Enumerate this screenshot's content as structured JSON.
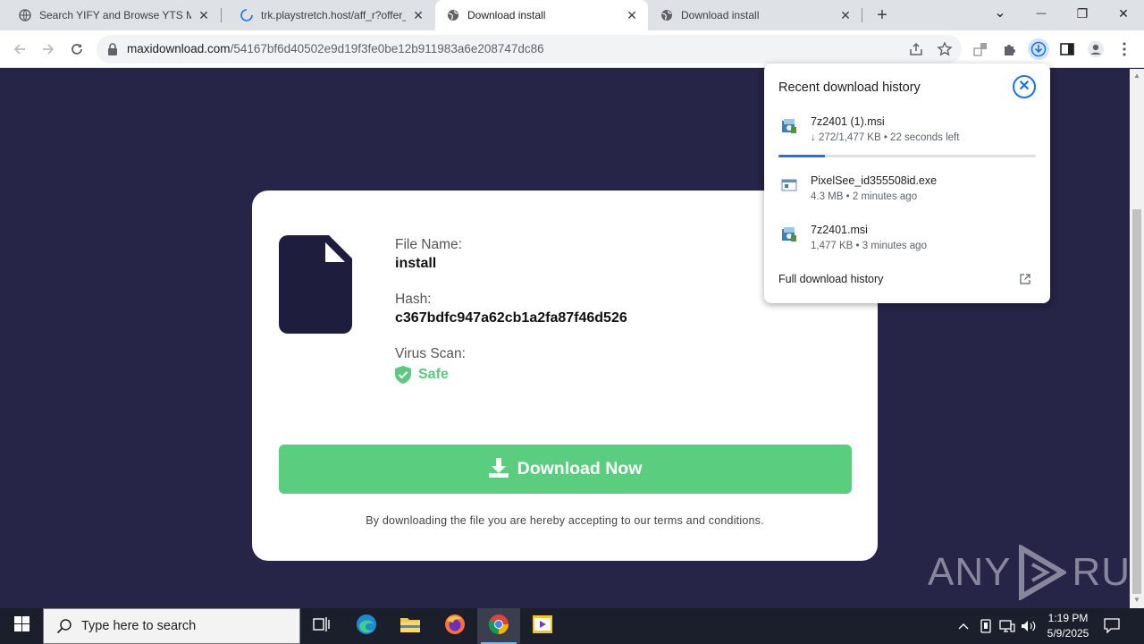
{
  "browser": {
    "tabs": [
      {
        "title": "Search YIFY and Browse YTS Mo",
        "favicon": "globe-icon"
      },
      {
        "title": "trk.playstretch.host/aff_r?offer_id",
        "favicon": "loading-icon"
      },
      {
        "title": "Download install",
        "favicon": "globe-icon",
        "active": true
      },
      {
        "title": "Download install",
        "favicon": "globe-icon"
      }
    ],
    "new_tab_symbol": "+",
    "window_controls": {
      "dropdown": "⌄",
      "minimize": "—",
      "restore": "❐",
      "close": "✕"
    },
    "address_domain": "maxidownload.com",
    "address_path": "/54167bf6d40502e9d19f3fe0be12b911983a6e208747dc86"
  },
  "page": {
    "file_name_label": "File Name:",
    "file_name": "install",
    "hash_label": "Hash:",
    "hash": "c367bdfc947a62cb1a2fa87f46d526",
    "virus_scan_label": "Virus Scan:",
    "virus_scan_status": "Safe",
    "download_button": "Download Now",
    "terms": "By downloading the file you are hereby accepting to our terms and conditions.",
    "accent_color": "#5bcd7f",
    "background_color": "#262447"
  },
  "watermark": {
    "left": "ANY",
    "right": "RUN"
  },
  "download_panel": {
    "title": "Recent download history",
    "close_symbol": "✕",
    "items": [
      {
        "name": "7z2401 (1).msi",
        "status": "↓ 272/1,477 KB • 22 seconds left",
        "progress": 0.18
      },
      {
        "name": "PixelSee_id355508id.exe",
        "status": "4.3 MB • 2 minutes ago"
      },
      {
        "name": "7z2401.msi",
        "status": "1,477 KB • 3 minutes ago"
      }
    ],
    "full_history": "Full download history"
  },
  "taskbar": {
    "search_placeholder": "Type here to search",
    "time": "1:19 PM",
    "date": "5/9/2025"
  }
}
